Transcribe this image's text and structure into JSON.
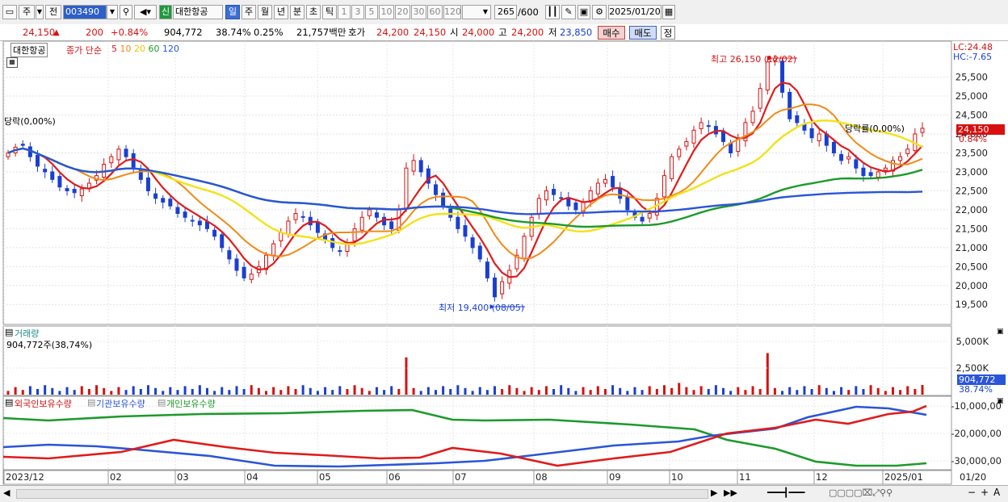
{
  "toolbar": {
    "mode": "주",
    "prev": "전",
    "code": "003490",
    "sin": "신",
    "name": "대한항공",
    "periods": [
      "일",
      "주",
      "월",
      "년",
      "분",
      "초",
      "틱"
    ],
    "active_period": "일",
    "nums": [
      "1",
      "3",
      "5",
      "10",
      "20",
      "30",
      "60",
      "120"
    ],
    "count": "265",
    "count_total": "/600",
    "date": "2025/01/20"
  },
  "info": {
    "price": "24,150",
    "arrow": "▲",
    "change": "200",
    "change_pct": "+0.84%",
    "volume": "904,772",
    "vol_ratio": "38.74%",
    "turnover": "0.25%",
    "amount": "21,757백만",
    "hoga_label": "호가",
    "hoga_ask": "24,200",
    "hoga_bid": "24,150",
    "open_label": "시",
    "open": "24,000",
    "high_label": "고",
    "high": "24,200",
    "low_label": "저",
    "low": "23,850",
    "buy": "매수",
    "sell": "매도",
    "extra": "정"
  },
  "colors": {
    "up": "#d81010",
    "down": "#1a3fd0",
    "ma5": "#e01b1b",
    "ma10": "#f08a16",
    "ma20": "#f2e21a",
    "ma60": "#1c9a2a",
    "ma120": "#2a55d8"
  },
  "chart_data": {
    "type": "candlestick",
    "price_legend": {
      "name": "대한항공",
      "close_label": "종가 단순",
      "ma": [
        {
          "period": "5",
          "color": "#e01b1b"
        },
        {
          "period": "10",
          "color": "#f08a16"
        },
        {
          "period": "20",
          "color": "#e8c800"
        },
        {
          "period": "60",
          "color": "#1c9a2a"
        },
        {
          "period": "120",
          "color": "#2a55d8"
        }
      ]
    },
    "y_ticks": [
      "25,500",
      "25,000",
      "24,500",
      "24,000",
      "23,500",
      "23,000",
      "22,500",
      "22,000",
      "21,500",
      "21,000",
      "20,500",
      "20,000",
      "19,500"
    ],
    "y_range": [
      19100,
      26450
    ],
    "x_labels": [
      "2023/12",
      "02",
      "03",
      "04",
      "05",
      "06",
      "07",
      "08",
      "09",
      "10",
      "11",
      "12",
      "2025/01",
      "01/20"
    ],
    "annotations": {
      "high": "최고 26,150 (12/02)",
      "low": "최저 19,400 (08/05)",
      "ratio_left": "당락(0,00%)",
      "ratio_right": "당락률(0,00%)",
      "lc": "LC:24.48",
      "hc": "HC:-7.65",
      "last_price": "24,150",
      "last_pct": "0.84%"
    },
    "close_series": [
      23500,
      23650,
      23700,
      23400,
      23150,
      23000,
      22800,
      22600,
      22500,
      22450,
      22550,
      22700,
      22900,
      23200,
      23400,
      23600,
      23400,
      23100,
      22800,
      22500,
      22300,
      22200,
      22100,
      21900,
      21800,
      21700,
      21600,
      21500,
      21300,
      21000,
      20700,
      20400,
      20200,
      20300,
      20500,
      20800,
      21100,
      21400,
      21700,
      21900,
      21800,
      21600,
      21400,
      21200,
      21000,
      20900,
      21100,
      21500,
      21800,
      22000,
      21800,
      21600,
      21500,
      22000,
      23100,
      23300,
      23000,
      22700,
      22400,
      22100,
      21800,
      21500,
      21300,
      21000,
      20700,
      20200,
      19700,
      20100,
      20400,
      20800,
      21300,
      21800,
      22300,
      22500,
      22400,
      22300,
      22100,
      22000,
      22200,
      22500,
      22700,
      22800,
      22600,
      22300,
      22000,
      21800,
      21700,
      21900,
      22300,
      22900,
      23400,
      23600,
      23800,
      24100,
      24300,
      24200,
      24000,
      23800,
      23500,
      23900,
      24300,
      24600,
      25200,
      25900,
      26000,
      25100,
      24400,
      24300,
      24100,
      23900,
      24000,
      23700,
      23500,
      23300,
      23400,
      23100,
      22900,
      22900,
      23000,
      23100,
      23300,
      23400,
      23600,
      24000,
      24150
    ],
    "volume": {
      "title": "거래량",
      "value_label": "904,772주(38,74%)",
      "y_ticks": [
        "5,000K",
        "2,500K"
      ],
      "last": "904,772",
      "last_pct": "38.74%"
    },
    "holders": {
      "labels": [
        "외국인보유수량",
        "기관보유수량",
        "개인보유수량"
      ],
      "y_ticks": [
        "-10,000,00",
        "-20,000,00",
        "-30,000,00"
      ]
    }
  }
}
